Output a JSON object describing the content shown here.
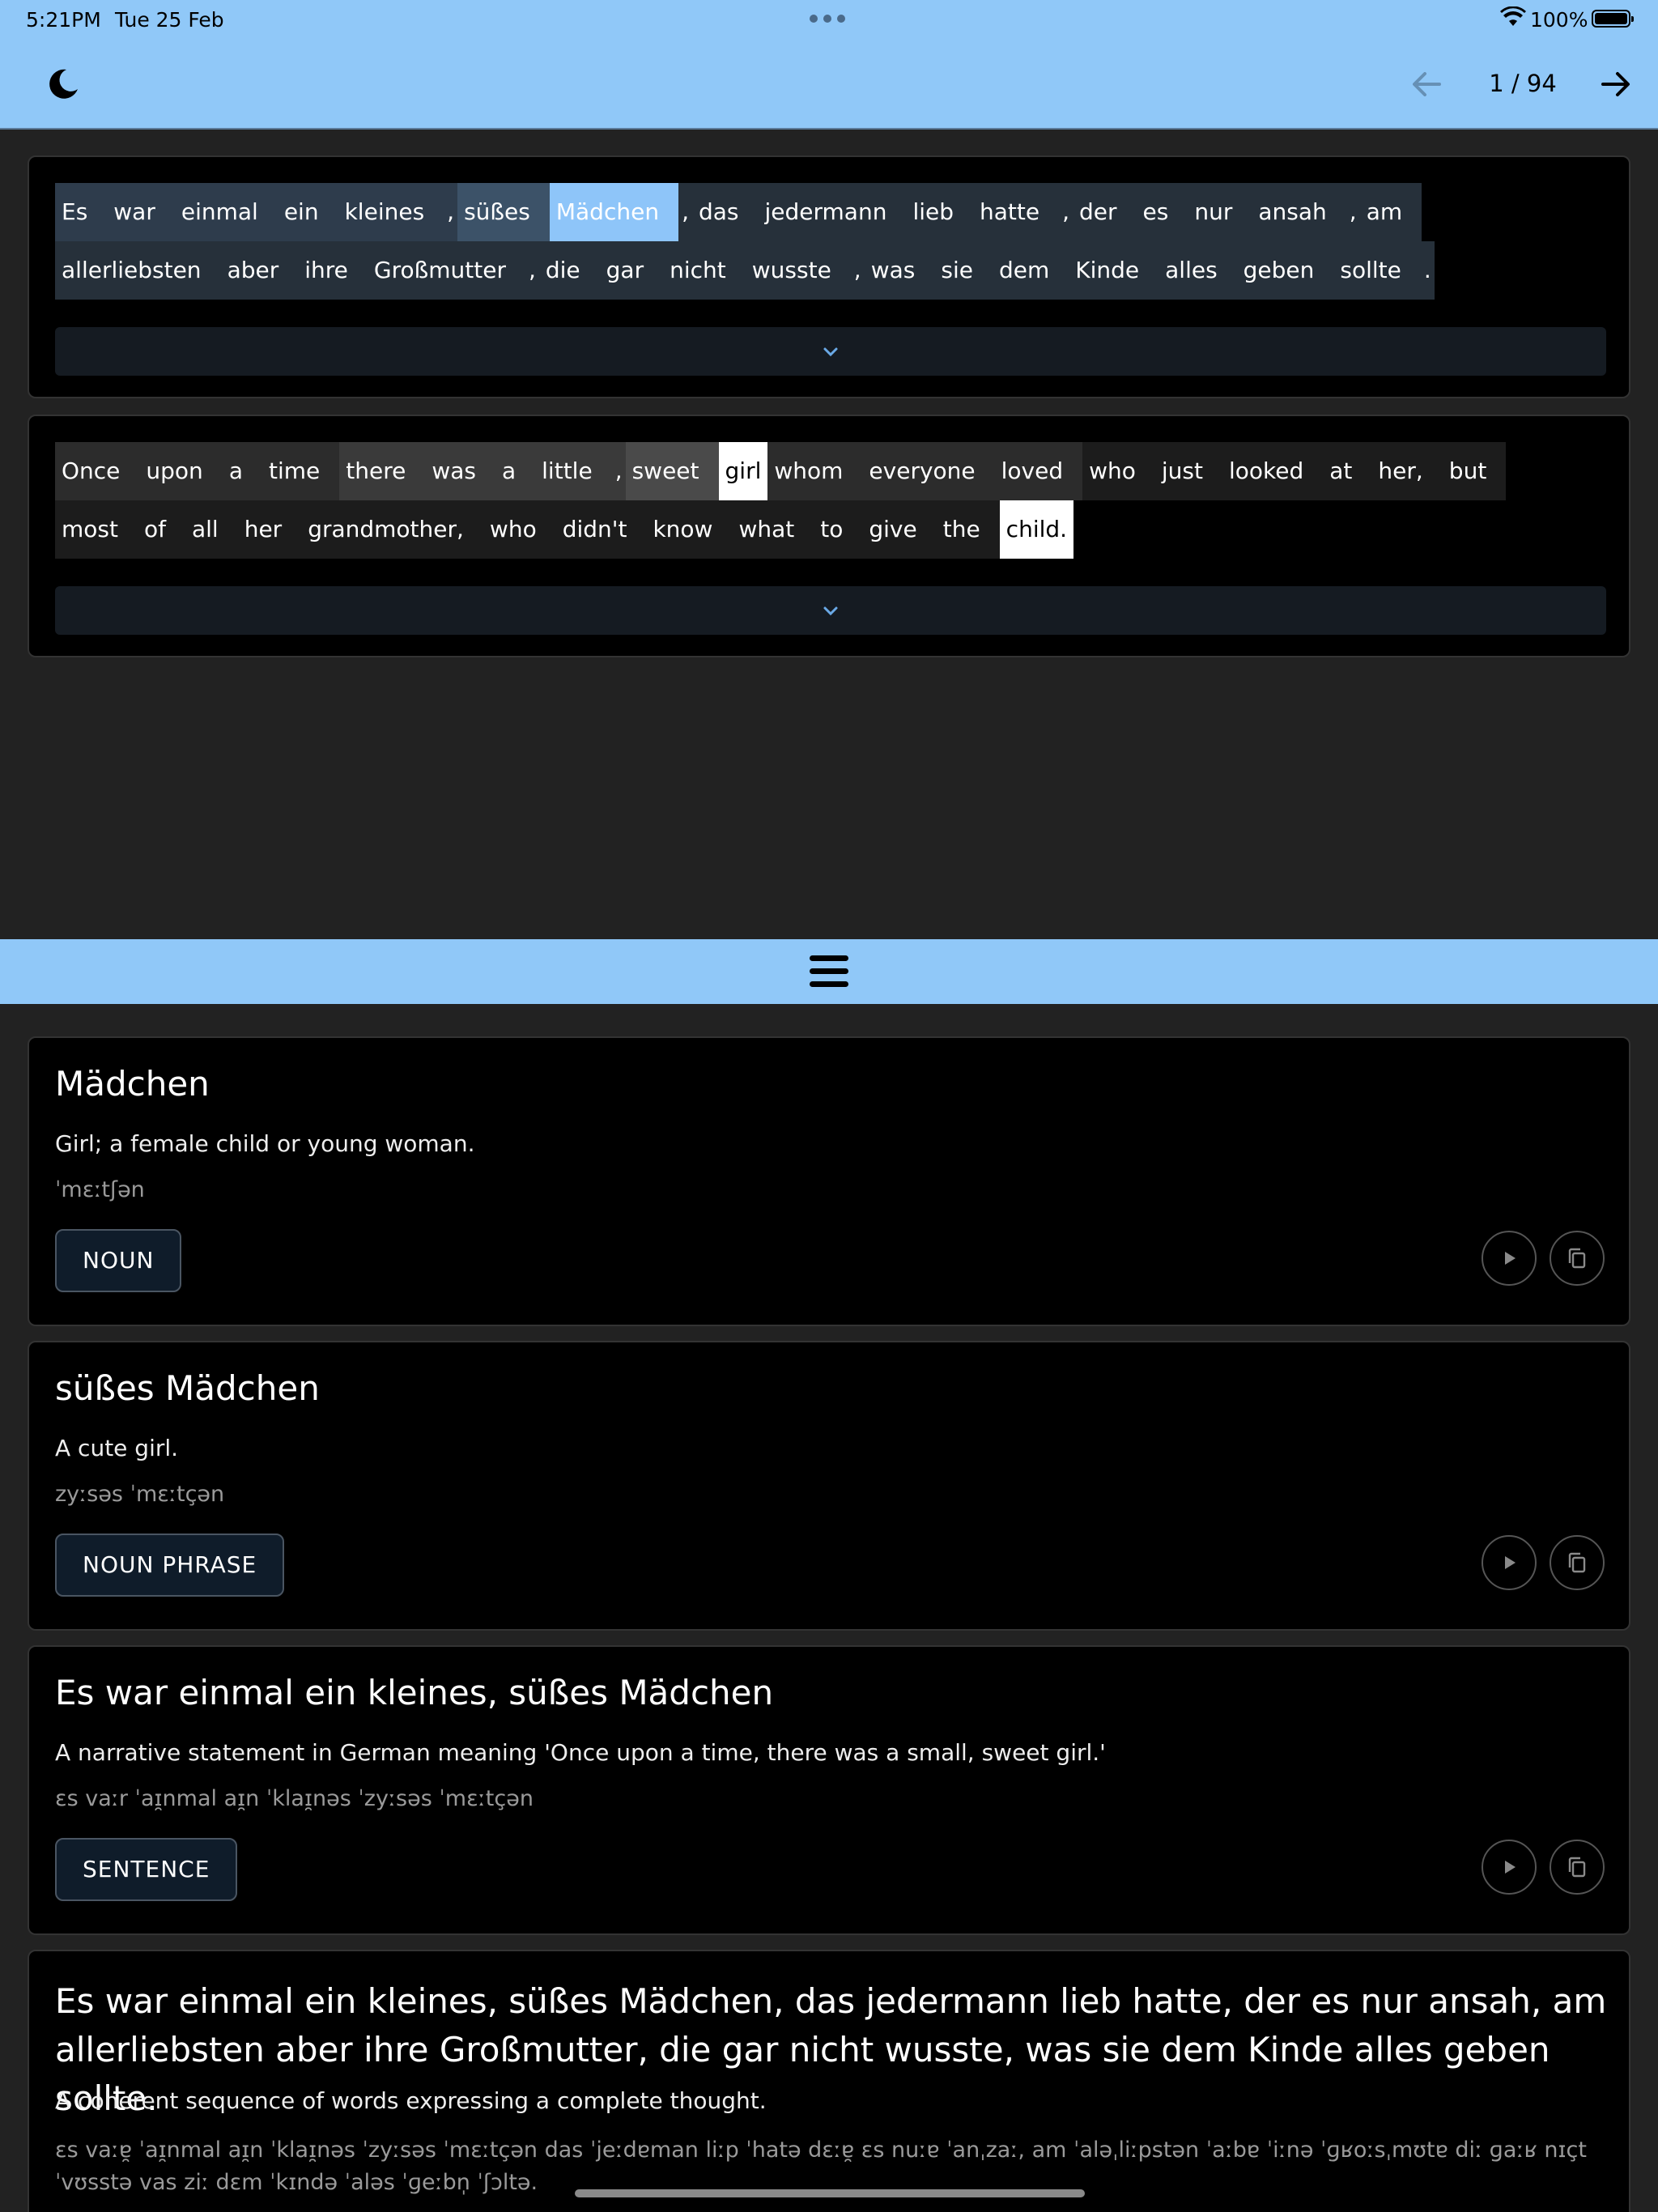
{
  "status": {
    "time": "5:21PM",
    "date": "Tue 25 Feb",
    "battery": "100%"
  },
  "toolbar": {
    "page": "1 / 94",
    "icons": [
      "moon-icon",
      "arrow-left-icon",
      "arrow-right-icon"
    ]
  },
  "colors": {
    "bar": "#90c8f8",
    "background": "#222222",
    "card": "#000000",
    "selected": "#8ec5f9"
  },
  "german": {
    "lines": [
      [
        {
          "t": "Es",
          "bg": "#2e3c4c"
        },
        {
          "t": "war",
          "bg": "#2e3c4c"
        },
        {
          "t": "einmal",
          "bg": "#2e3c4c"
        },
        {
          "t": "ein",
          "bg": "#2e3c4c"
        },
        {
          "t": "kleines",
          "bg": "#2e3c4c"
        },
        {
          "t": ",",
          "bg": "#2e3c4c",
          "p": true
        },
        {
          "t": "süßes",
          "bg": "#3c5268"
        },
        {
          "t": "Mädchen",
          "bg": "#8ec5f9"
        },
        {
          "t": ",",
          "bg": "#26303a",
          "p": true
        },
        {
          "t": "das",
          "bg": "#26303a"
        },
        {
          "t": "jedermann",
          "bg": "#26303a"
        },
        {
          "t": "lieb",
          "bg": "#26303a"
        },
        {
          "t": "hatte",
          "bg": "#26303a"
        },
        {
          "t": ",",
          "bg": "#26303a",
          "p": true
        },
        {
          "t": "der",
          "bg": "#26303a"
        },
        {
          "t": "es",
          "bg": "#26303a"
        },
        {
          "t": "nur",
          "bg": "#26303a"
        },
        {
          "t": "ansah",
          "bg": "#26303a"
        },
        {
          "t": ",",
          "bg": "#26303a",
          "p": true
        },
        {
          "t": "am",
          "bg": "#26303a"
        }
      ],
      [
        {
          "t": "allerliebsten",
          "bg": "#26303a"
        },
        {
          "t": "aber",
          "bg": "#26303a"
        },
        {
          "t": "ihre",
          "bg": "#26303a"
        },
        {
          "t": "Großmutter",
          "bg": "#26303a"
        },
        {
          "t": ",",
          "bg": "#26303a",
          "p": true
        },
        {
          "t": "die",
          "bg": "#26303a"
        },
        {
          "t": "gar",
          "bg": "#26303a"
        },
        {
          "t": "nicht",
          "bg": "#26303a"
        },
        {
          "t": "wusste",
          "bg": "#26303a"
        },
        {
          "t": ",",
          "bg": "#26303a",
          "p": true
        },
        {
          "t": "was",
          "bg": "#26303a"
        },
        {
          "t": "sie",
          "bg": "#26303a"
        },
        {
          "t": "dem",
          "bg": "#26303a"
        },
        {
          "t": "Kinde",
          "bg": "#26303a"
        },
        {
          "t": "alles",
          "bg": "#26303a"
        },
        {
          "t": "geben",
          "bg": "#26303a"
        },
        {
          "t": "sollte",
          "bg": "#26303a"
        },
        {
          "t": ".",
          "bg": "#26303a",
          "p": true
        }
      ]
    ]
  },
  "english": {
    "lines": [
      [
        {
          "t": "Once",
          "bg": "#2c2c2c"
        },
        {
          "t": "upon",
          "bg": "#2c2c2c"
        },
        {
          "t": "a",
          "bg": "#2c2c2c"
        },
        {
          "t": "time",
          "bg": "#2c2c2c"
        },
        {
          "t": "there",
          "bg": "#3a3a3a"
        },
        {
          "t": "was",
          "bg": "#3a3a3a"
        },
        {
          "t": "a",
          "bg": "#3a3a3a"
        },
        {
          "t": "little",
          "bg": "#3a3a3a"
        },
        {
          "t": ",",
          "bg": "#3a3a3a",
          "p": true
        },
        {
          "t": "sweet",
          "bg": "#4a4a4a"
        },
        {
          "t": "girl",
          "bg": "#ffffff",
          "dark": true
        },
        {
          "t": "whom",
          "bg": "#2c2c2c"
        },
        {
          "t": "everyone",
          "bg": "#2c2c2c"
        },
        {
          "t": "loved",
          "bg": "#2c2c2c"
        },
        {
          "t": "who",
          "bg": "#1c1c1c"
        },
        {
          "t": "just",
          "bg": "#1c1c1c"
        },
        {
          "t": "looked",
          "bg": "#1c1c1c"
        },
        {
          "t": "at",
          "bg": "#1c1c1c"
        },
        {
          "t": "her,",
          "bg": "#1c1c1c"
        },
        {
          "t": "but",
          "bg": "#1c1c1c"
        }
      ],
      [
        {
          "t": "most",
          "bg": "#1c1c1c"
        },
        {
          "t": "of",
          "bg": "#1c1c1c"
        },
        {
          "t": "all",
          "bg": "#1c1c1c"
        },
        {
          "t": "her",
          "bg": "#1c1c1c"
        },
        {
          "t": "grandmother,",
          "bg": "#1c1c1c"
        },
        {
          "t": "who",
          "bg": "#1c1c1c"
        },
        {
          "t": "didn't",
          "bg": "#1c1c1c"
        },
        {
          "t": "know",
          "bg": "#1c1c1c"
        },
        {
          "t": "what",
          "bg": "#1c1c1c"
        },
        {
          "t": "to",
          "bg": "#1c1c1c"
        },
        {
          "t": "give",
          "bg": "#1c1c1c"
        },
        {
          "t": "the",
          "bg": "#1c1c1c"
        },
        {
          "t": "child.",
          "bg": "#ffffff",
          "dark": true
        }
      ]
    ]
  },
  "cards": [
    {
      "title": "Mädchen",
      "definition": "Girl; a female child or young woman.",
      "ipa": "ˈmɛːtʃən",
      "tag": "NOUN"
    },
    {
      "title": "süßes Mädchen",
      "definition": "A cute girl.",
      "ipa": "zyːsəs ˈmɛːtçən",
      "tag": "NOUN PHRASE"
    },
    {
      "title": "Es war einmal ein kleines, süßes Mädchen",
      "definition": "A narrative statement in German meaning 'Once upon a time, there was a small, sweet girl.'",
      "ipa": "ɛs vaːr ˈaɪ̯nmal aɪ̯n ˈklaɪ̯nəs ˈzyːsəs ˈmɛːtçən",
      "tag": "SENTENCE"
    },
    {
      "title": "Es war einmal ein kleines, süßes Mädchen, das jedermann lieb hatte, der es nur ansah, am allerliebsten aber ihre Großmutter, die gar nicht wusste, was sie dem Kinde alles geben sollte.",
      "definition": "A coherent sequence of words expressing a complete thought.",
      "ipa": "ɛs vaːɐ̯ ˈaɪ̯nmal aɪ̯n ˈklaɪ̯nəs ˈzyːsəs ˈmɛːtçən das ˈjeːdɐman liːp ˈhatə dɛːɐ̯ ɛs nuːɐ ˈanˌzaː, am ˈaləˌliːpstən ˈaːbɐ ˈiːnə ˈɡʁoːsˌmʊtɐ diː ɡaːʁ nɪçt ˈvʊsstə vas ziː dɛm ˈkɪndə ˈaləs ˈɡeːbn̩ ˈʃɔltə."
    }
  ]
}
